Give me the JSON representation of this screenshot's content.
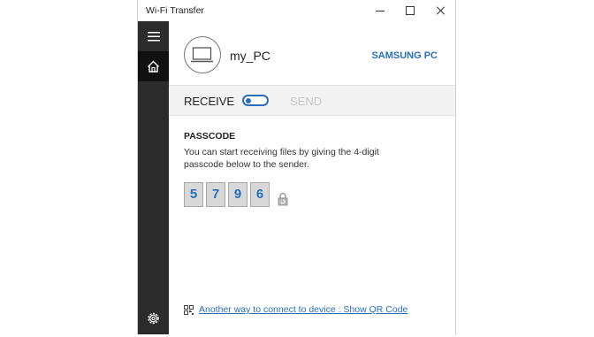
{
  "window": {
    "title": "Wi-Fi Transfer"
  },
  "sidebar": {
    "menu_icon": "hamburger-icon",
    "home_icon": "home-icon",
    "settings_icon": "gear-icon"
  },
  "device": {
    "name": "my_PC",
    "type_label": "SAMSUNG PC",
    "icon": "laptop-icon"
  },
  "mode": {
    "receive_label": "RECEIVE",
    "send_label": "SEND",
    "selected": "RECEIVE"
  },
  "passcode": {
    "title": "PASSCODE",
    "description": "You can start receiving files by giving the 4-digit passcode below to the sender.",
    "digits": [
      "5",
      "7",
      "9",
      "6"
    ]
  },
  "qr": {
    "icon": "qr-code-icon",
    "link_text": "Another way to connect to device : Show QR Code"
  },
  "colors": {
    "accent": "#2a6ebb",
    "sidebar": "#2b2b2b",
    "sidebar_selected": "#111111"
  }
}
